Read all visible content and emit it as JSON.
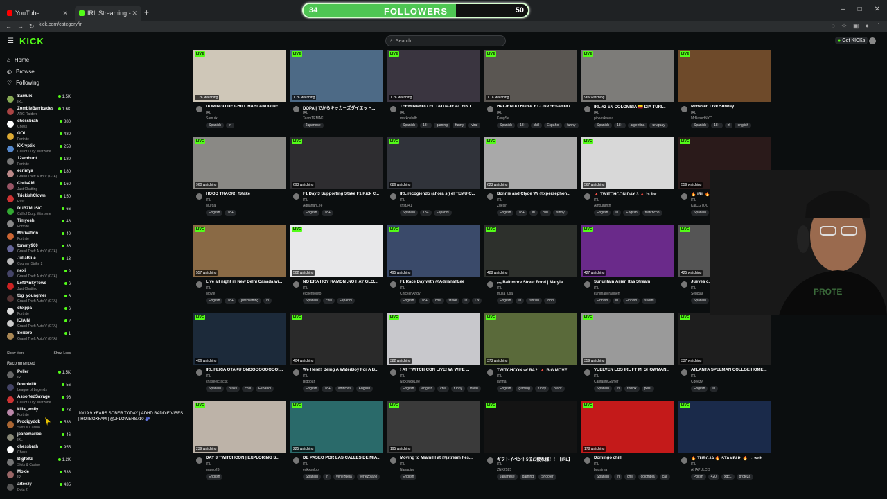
{
  "browser": {
    "tabs": [
      {
        "label": "YouTube",
        "color": "#ff0000"
      },
      {
        "label": "IRL Streaming - Live Streams on K",
        "color": "#53fc18"
      }
    ],
    "url": "kick.com/category/irl",
    "new_tab": "+",
    "window_controls": [
      "–",
      "□",
      "✕"
    ]
  },
  "overlay": {
    "followers_label": "FOLLOWERS",
    "current": "34",
    "goal": "50",
    "progress": 0.68
  },
  "header": {
    "logo": "KICK",
    "search_placeholder": "Search",
    "get_kicks": "Get KICKs"
  },
  "sidebar": {
    "nav": [
      {
        "label": "Home",
        "icon": "home-icon"
      },
      {
        "label": "Browse",
        "icon": "compass-icon"
      },
      {
        "label": "Following",
        "icon": "heart-icon"
      }
    ],
    "following": [
      {
        "name": "Samuix",
        "game": "IRL",
        "count": "1.5K",
        "color": "#8a5"
      },
      {
        "name": "ZombieBarricades",
        "game": "ARC Raiders",
        "count": "1.6K",
        "color": "#a44"
      },
      {
        "name": "chessbrah",
        "game": "Chess",
        "count": "880",
        "color": "#fff"
      },
      {
        "name": "OOL",
        "game": "Fortnite",
        "count": "480",
        "color": "#da3"
      },
      {
        "name": "KKryptix",
        "game": "Call of Duty: Warzone",
        "count": "253",
        "color": "#58c"
      },
      {
        "name": "12amhunt",
        "game": "Fortnite",
        "count": "180",
        "color": "#777"
      },
      {
        "name": "ecrimya",
        "game": "Grand Theft Auto V (GTA)",
        "count": "180",
        "color": "#b88"
      },
      {
        "name": "ChrisAM",
        "game": "Just Chatting",
        "count": "160",
        "color": "#956"
      },
      {
        "name": "TrickishClown",
        "game": "Rust",
        "count": "150",
        "color": "#c33"
      },
      {
        "name": "DUBZMUSIC",
        "game": "Call of Duty: Warzone",
        "count": "66",
        "color": "#3a3"
      },
      {
        "name": "Timyoshi",
        "game": "Fortnite",
        "count": "48",
        "color": "#888"
      },
      {
        "name": "Motivation",
        "game": "Fortnite",
        "count": "40",
        "color": "#c63"
      },
      {
        "name": "tommy900",
        "game": "Grand Theft Auto V (GTA)",
        "count": "36",
        "color": "#669"
      },
      {
        "name": "JuliaBlue",
        "game": "Counter-Strike 2",
        "count": "13",
        "color": "#bbb"
      },
      {
        "name": "nexi",
        "game": "Grand Theft Auto V (GTA)",
        "count": "9",
        "color": "#446"
      },
      {
        "name": "LeftPinkyTowe",
        "game": "Just Chatting",
        "count": "6",
        "color": "#c22"
      },
      {
        "name": "tbg_youngmer",
        "game": "Grand Theft Auto V (GTA)",
        "count": "6",
        "color": "#533"
      },
      {
        "name": "chxppa",
        "game": "Fortnite",
        "count": "6",
        "color": "#ddd"
      },
      {
        "name": "ICIAIN",
        "game": "Grand Theft Auto V (GTA)",
        "count": "2",
        "color": "#ccc"
      },
      {
        "name": "Seizero",
        "game": "Grand Theft Auto V (GTA)",
        "count": "1",
        "color": "#a85"
      }
    ],
    "show_more": "Show More",
    "show_less": "Show Less",
    "recommended_title": "Recommended",
    "recommended": [
      {
        "name": "Peller",
        "game": "IRL",
        "count": "1.5K",
        "color": "#666"
      },
      {
        "name": "Doublelift",
        "game": "League of Legends",
        "count": "56",
        "color": "#446"
      },
      {
        "name": "AssortedSavage",
        "game": "Call of Duty: Warzone",
        "count": "96",
        "color": "#c33"
      },
      {
        "name": "killa_emily",
        "game": "Fortnite",
        "count": "73",
        "color": "#b8a"
      },
      {
        "name": "Prodigyddk",
        "game": "Slots & Casino",
        "count": "538",
        "color": "#a63"
      },
      {
        "name": "jeanemariee",
        "game": "IRL",
        "count": "46",
        "color": "#887"
      },
      {
        "name": "chessbrah",
        "game": "Chess",
        "count": "955",
        "color": "#fff"
      },
      {
        "name": "Bigfoltz",
        "game": "Slots & Casino",
        "count": "1.2K",
        "color": "#777"
      },
      {
        "name": "Moxie",
        "game": "IRL",
        "count": "533",
        "color": "#966"
      },
      {
        "name": "arteezy",
        "game": "Dota 2",
        "count": "435",
        "color": "#555"
      }
    ],
    "tooltip": "10/19 9 YEARS SOBER TODAY | ADHD BADDIE VIBES | HOTBOXFAM | @JFLOWERS710 🫐"
  },
  "live_label": "LIVE",
  "streams": [
    {
      "title": "DOMINGO DE CHILL HABLANDO DE ...",
      "category": "IRL",
      "streamer": "Samuix",
      "watching": "1.2K watching",
      "tags": [
        "Spanish",
        "irl"
      ],
      "bg": "#cfc7b8"
    },
    {
      "title": "DOPA | でからキッカーズダイエット...",
      "category": "IRL",
      "streamer": "TeamTEMAKI",
      "watching": "1.2K watching",
      "tags": [
        "Japanese"
      ],
      "bg": "#4d6a86"
    },
    {
      "title": "TERMINANDO EL TATUAJE AL FIN L...",
      "category": "IRL",
      "streamer": "markoshdfr",
      "watching": "1.2K watching",
      "tags": [
        "Spanish",
        "18+",
        "gaming",
        "funny",
        "viral"
      ],
      "bg": "#3a3540"
    },
    {
      "title": "HACIENDO HORA Y CONVERSANDO...",
      "category": "IRL",
      "streamer": "KongSe",
      "watching": "1.1K watching",
      "tags": [
        "Spanish",
        "18+",
        "chill",
        "Español",
        "funny"
      ],
      "bg": "#5a5652"
    },
    {
      "title": "IRL #2 EN COLOMBIA 🇨🇴 DÍA TURI...",
      "category": "IRL",
      "streamer": "pipeeskatela",
      "watching": "966 watching",
      "tags": [
        "Spanish",
        "18+",
        "argentina",
        "uruguay"
      ],
      "bg": "#7d7c79"
    },
    {
      "title": "MrBased Live Sunday!",
      "category": "IRL",
      "streamer": "MrBasedNYC",
      "watching": "",
      "tags": [
        "Spanish",
        "18+",
        "irl",
        "english"
      ],
      "bg": "#6e4a2a"
    },
    {
      "title": "HOOD TRACK!! /Stake",
      "category": "IRL",
      "streamer": "Murda",
      "watching": "960 watching",
      "tags": [
        "English",
        "18+"
      ],
      "bg": "#8a8985"
    },
    {
      "title": "F1 Day 3 Supporting Stake F1 Kick C...",
      "category": "IRL",
      "streamer": "AdrianahLee",
      "watching": "693 watching",
      "tags": [
        "English",
        "18+"
      ],
      "bg": "#2e2d30"
    },
    {
      "title": "IRL recogiendo (ahora sí) el TEMU C...",
      "category": "IRL",
      "streamer": "crist341",
      "watching": "686 watching",
      "tags": [
        "Spanish",
        "18+",
        "Español"
      ],
      "bg": "#30333a"
    },
    {
      "title": "Bonnie and Clyde W/ @xpersephon...",
      "category": "IRL",
      "streamer": "Zuesirl",
      "watching": "623 watching",
      "tags": [
        "English",
        "18+",
        "irl",
        "chill",
        "funny"
      ],
      "bg": "#a9a9a9"
    },
    {
      "title": "🔺 TWITCHCON DAY 3 🔺 !s for ...",
      "category": "IRL",
      "streamer": "Amouranth",
      "watching": "567 watching",
      "tags": [
        "English",
        "irl",
        "English",
        "twitchcon"
      ],
      "bg": "#d8d8d8"
    },
    {
      "title": "🔥 IRL 🔥",
      "category": "IRL",
      "streamer": "KaiCGTOC",
      "watching": "559 watching",
      "tags": [
        "Spanish"
      ],
      "bg": "#2a1a1a"
    },
    {
      "title": "Live all night in New Delhi Canada wi...",
      "category": "IRL",
      "streamer": "Movie",
      "watching": "557 watching",
      "tags": [
        "English",
        "18+",
        "justchatting",
        "irl"
      ],
      "bg": "#8a6a45"
    },
    {
      "title": "NO ERA HOY RAMÓN ,NO HAY GLO...",
      "category": "IRL",
      "streamer": "elchefpollito",
      "watching": "502 watching",
      "tags": [
        "Spanish",
        "chill",
        "Español"
      ],
      "bg": "#e8e8ea"
    },
    {
      "title": "F1 Race Day with @AdrianahLee",
      "category": "IRL",
      "streamer": "ChickenAndy",
      "watching": "495 watching",
      "tags": [
        "English",
        "18+",
        "chill",
        "stake",
        "irl",
        "Cx"
      ],
      "bg": "#3a4a6a"
    },
    {
      "title": "ᵤₛₐ Baltimore Street Food | Maryla...",
      "category": "IRL",
      "streamer": "musa_usa",
      "watching": "488 watching",
      "tags": [
        "English",
        "irl",
        "turkish",
        "food"
      ],
      "bg": "#2d302c"
    },
    {
      "title": "Sununtain Äijien Itaa Stream",
      "category": "IRL",
      "streamer": "kuhimarvirallinen",
      "watching": "427 watching",
      "tags": [
        "Finnish",
        "irl",
        "Finnish",
        "suomi"
      ],
      "bg": "#6a2a8a"
    },
    {
      "title": "Jueves c...",
      "category": "IRL",
      "streamer": "Seb899",
      "watching": "425 watching",
      "tags": [
        "Spanish"
      ],
      "bg": "#555"
    },
    {
      "title": "IRL FERIA OTAKU OÑOOOOOOOOO!...",
      "category": "IRL",
      "streamer": "chaseelcrackk",
      "watching": "406 watching",
      "tags": [
        "Spanish",
        "otaku",
        "chill",
        "Español"
      ],
      "bg": "#1c2a3a"
    },
    {
      "title": "We Here!! Being A WaterBoy For A B...",
      "category": "IRL",
      "streamer": "Bigboaf",
      "watching": "404 watching",
      "tags": [
        "English",
        "18+",
        "adinross",
        "English"
      ],
      "bg": "#2a2a2a"
    },
    {
      "title": "! AT TWITCH CON LIVE! W/ WIFE ...",
      "category": "IRL",
      "streamer": "NickWickLee",
      "watching": "382 watching",
      "tags": [
        "English",
        "english",
        "chill",
        "funny",
        "travel"
      ],
      "bg": "#c8c8cc"
    },
    {
      "title": "TWITCHCON w/ RA?! 🔺 BIG MOVE...",
      "category": "IRL",
      "streamer": "lamffa",
      "watching": "373 watching",
      "tags": [
        "English",
        "gaming",
        "funny",
        "black"
      ],
      "bg": "#5a6a3a"
    },
    {
      "title": "VUELVEN LOS IRL FT MI SHOWMAN...",
      "category": "IRL",
      "streamer": "CantanteGamer",
      "watching": "359 watching",
      "tags": [
        "Spanish",
        "irl",
        "roblox",
        "peru"
      ],
      "bg": "#9a9a9a"
    },
    {
      "title": "ATLANTA SPELMAN COLLGE HOME...",
      "category": "IRL",
      "streamer": "Cgeezy",
      "watching": "337 watching",
      "tags": [
        "English",
        "irl"
      ],
      "bg": "#1e1e1e"
    },
    {
      "title": "DAY 3 TWITCHCON | EXPLORING S...",
      "category": "IRL",
      "streamer": "mateo28t",
      "watching": "239 watching",
      "tags": [
        "English"
      ],
      "bg": "#bdb3a8"
    },
    {
      "title": "DE PASEO POR LAS CALLES DE MIA...",
      "category": "IRL",
      "streamer": "erikxonlop",
      "watching": "225 watching",
      "tags": [
        "Spanish",
        "irl",
        "venezuela",
        "venezolano"
      ],
      "bg": "#2a6a6a"
    },
    {
      "title": "Moving to Miamilll at @jstream Fes...",
      "category": "IRL",
      "streamer": "Nanapips",
      "watching": "195 watching",
      "tags": [
        "English"
      ],
      "bg": "#3a3a3a"
    },
    {
      "title": "ギフトイベント5位お疲れ様！！【IRL】",
      "category": "IRL",
      "streamer": "ZNK2525",
      "watching": "",
      "tags": [
        "Japanese",
        "gaming",
        "Shooter"
      ],
      "bg": "#141414"
    },
    {
      "title": "Domingo chill",
      "category": "IRL",
      "streamer": "bquaima",
      "watching": "178 watching",
      "tags": [
        "Spanish",
        "irl",
        "chill",
        "colombia",
        "cali"
      ],
      "bg": "#c41a1a"
    },
    {
      "title": "🔥 TURCJA 🔥 STAMBUŁ 🔥 → wch...",
      "category": "IRL",
      "streamer": "AHAPULCO",
      "watching": "",
      "tags": [
        "Polish",
        "420",
        "xqcL",
        "proteza"
      ],
      "bg": "#1a2a4a"
    }
  ]
}
